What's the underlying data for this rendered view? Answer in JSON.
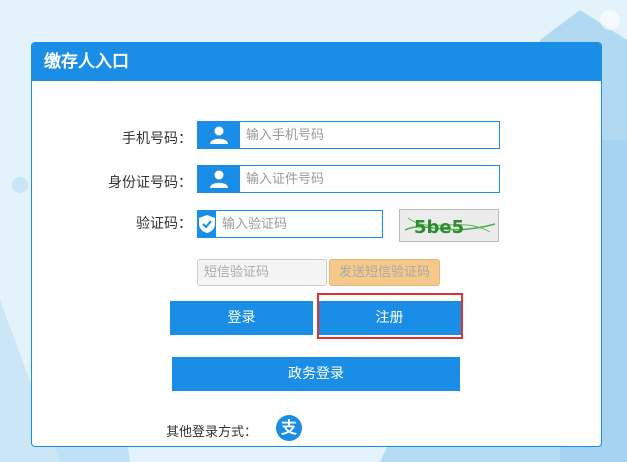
{
  "panel": {
    "title": "缴存人入口"
  },
  "form": {
    "phone": {
      "label": "手机号码：",
      "placeholder": "输入手机号码"
    },
    "id_number": {
      "label": "身份证号码：",
      "placeholder": "输入证件号码"
    },
    "captcha": {
      "label": "验证码：",
      "placeholder": "输入验证码",
      "image_text": "5be5"
    },
    "sms": {
      "placeholder": "短信验证码",
      "send_label": "发送短信验证码"
    }
  },
  "buttons": {
    "login": "登录",
    "register": "注册",
    "gov_login": "政务登录"
  },
  "other_login": {
    "label": "其他登录方式：",
    "alipay_icon": "支"
  },
  "colors": {
    "accent": "#1a8ee6",
    "highlight": "#e03232",
    "sms_button": "#f5c98c"
  }
}
